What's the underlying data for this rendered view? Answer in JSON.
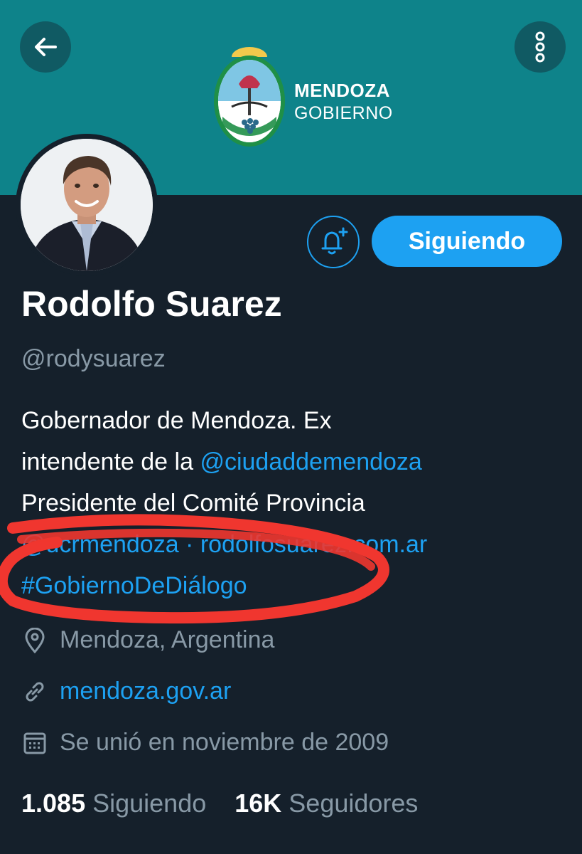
{
  "header": {
    "logo": {
      "line1": "MENDOZA",
      "line2": "GOBIERNO"
    },
    "back_icon": "arrow-left-icon",
    "more_icon": "more-vertical-icon"
  },
  "profile": {
    "name": "Rodolfo Suarez",
    "handle": "@rodysuarez",
    "follow_button_label": "Siguiendo",
    "notify_icon": "bell-plus-icon",
    "bio": {
      "line1": "Gobernador de Mendoza. Ex",
      "line2_text": "intendente de la ",
      "line2_mention": "@ciudaddemendoza",
      "line3": "Presidente del Comité Provincia",
      "line4": "@ucrmendoza · rodolfosuarez.com.ar",
      "line5_hashtag": "#GobiernoDeDiálogo"
    },
    "location": "Mendoza, Argentina",
    "website": "mendoza.gov.ar",
    "joined": "Se unió en noviembre de 2009"
  },
  "stats": {
    "following_count": "1.085",
    "following_label": "Siguiendo",
    "followers_count": "16K",
    "followers_label": "Seguidores"
  },
  "colors": {
    "banner": "#0e838a",
    "background": "#15202b",
    "accent": "#1da1f2",
    "secondary_text": "#8899a6",
    "annotation": "#f0362f"
  }
}
